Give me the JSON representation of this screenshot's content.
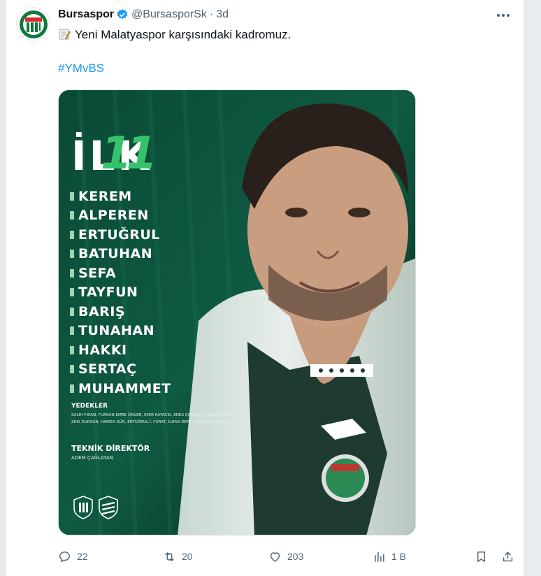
{
  "author": {
    "name": "Bursaspor",
    "handle": "@BursasporSk",
    "separator": "·",
    "time": "3d"
  },
  "tweet": {
    "text": "Yeni Malatyaspor karşısındaki kadromuz.",
    "hashtag": "#YMvBS",
    "emoji_icon": "memo-icon"
  },
  "image": {
    "title_word": "İLK",
    "title_number": "11",
    "players": [
      "KEREM",
      "ALPEREN",
      "ERTUĞRUL",
      "BATUHAN",
      "SEFA",
      "TAYFUN",
      "BARIŞ",
      "TUNAHAN",
      "HAKKI",
      "SERTAÇ",
      "MUHAMMET"
    ],
    "subs_title": "YEDEKLER",
    "subs_text": "SALIH FIDAN, FURKAN EMRE ÜNVER, EMIR KAYACIK, ENES ÇALIŞKAN, SEDAT CENGIZ, ZEKI DURSUN, HAMZA GÜR, ERTUĞRUL İ. FURAT, İLHAN DEPE, EMRE HAN GEDIKLI",
    "coach_title": "TEKNİK DİREKTÖR",
    "coach_name": "ADEM ÇAĞLAYAN",
    "accent_color": "#35c26c",
    "bg_color": "#0d3a2c"
  },
  "actions": {
    "reply_count": "22",
    "retweet_count": "20",
    "like_count": "203",
    "views_count": "1 B"
  },
  "colors": {
    "link": "#1d9bf0",
    "muted": "#536471",
    "verified": "#1d9bf0"
  }
}
